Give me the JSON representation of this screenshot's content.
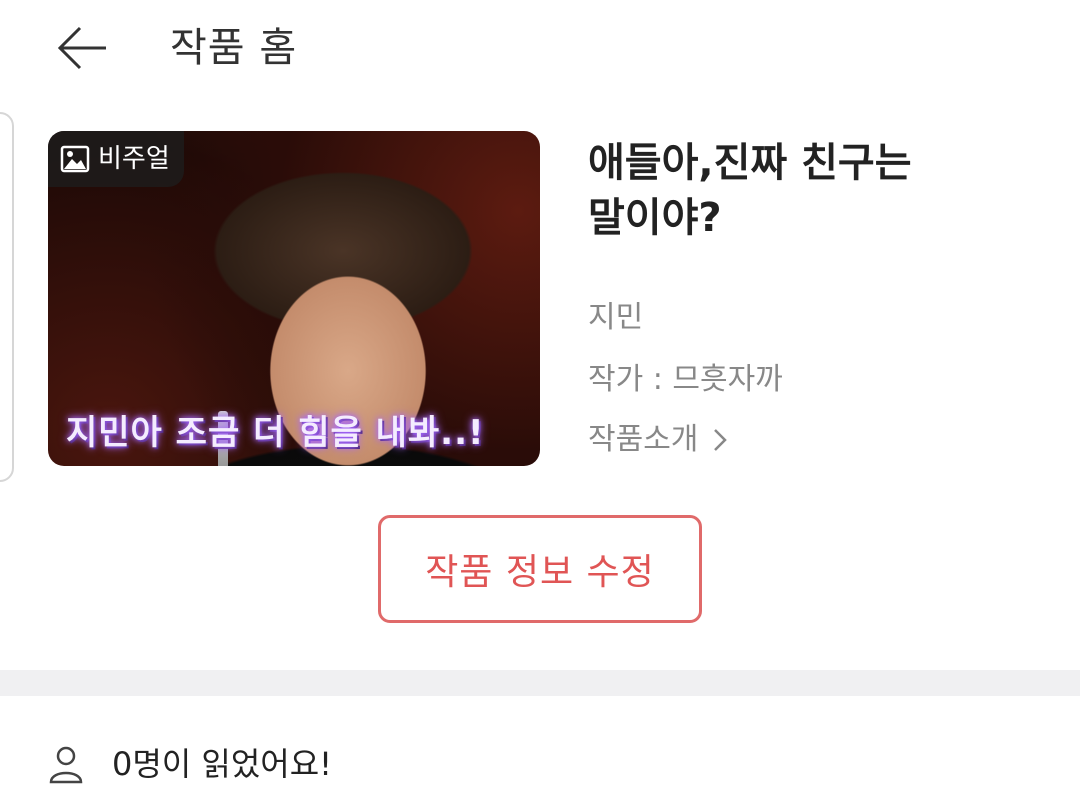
{
  "header": {
    "title": "작품 홈",
    "back_icon": "arrow-left-icon"
  },
  "work": {
    "visual_badge": "비주얼",
    "visual_icon": "image-icon",
    "cover_caption": "지민아 조금 더 힘을 내봐..!",
    "title": "애들아,진짜 친구는 말이야?",
    "character": "지민",
    "author_line": "작가 : 므흣자까",
    "intro_label": "작품소개",
    "intro_chevron": "chevron-right-icon"
  },
  "actions": {
    "edit_label": "작품 정보 수정"
  },
  "stats": {
    "person_icon": "person-icon",
    "read_text": "0명이 읽었어요!"
  },
  "colors": {
    "accent": "#e06a6a",
    "text_primary": "#222222",
    "text_secondary": "#888888",
    "band": "#f0f0f2"
  }
}
